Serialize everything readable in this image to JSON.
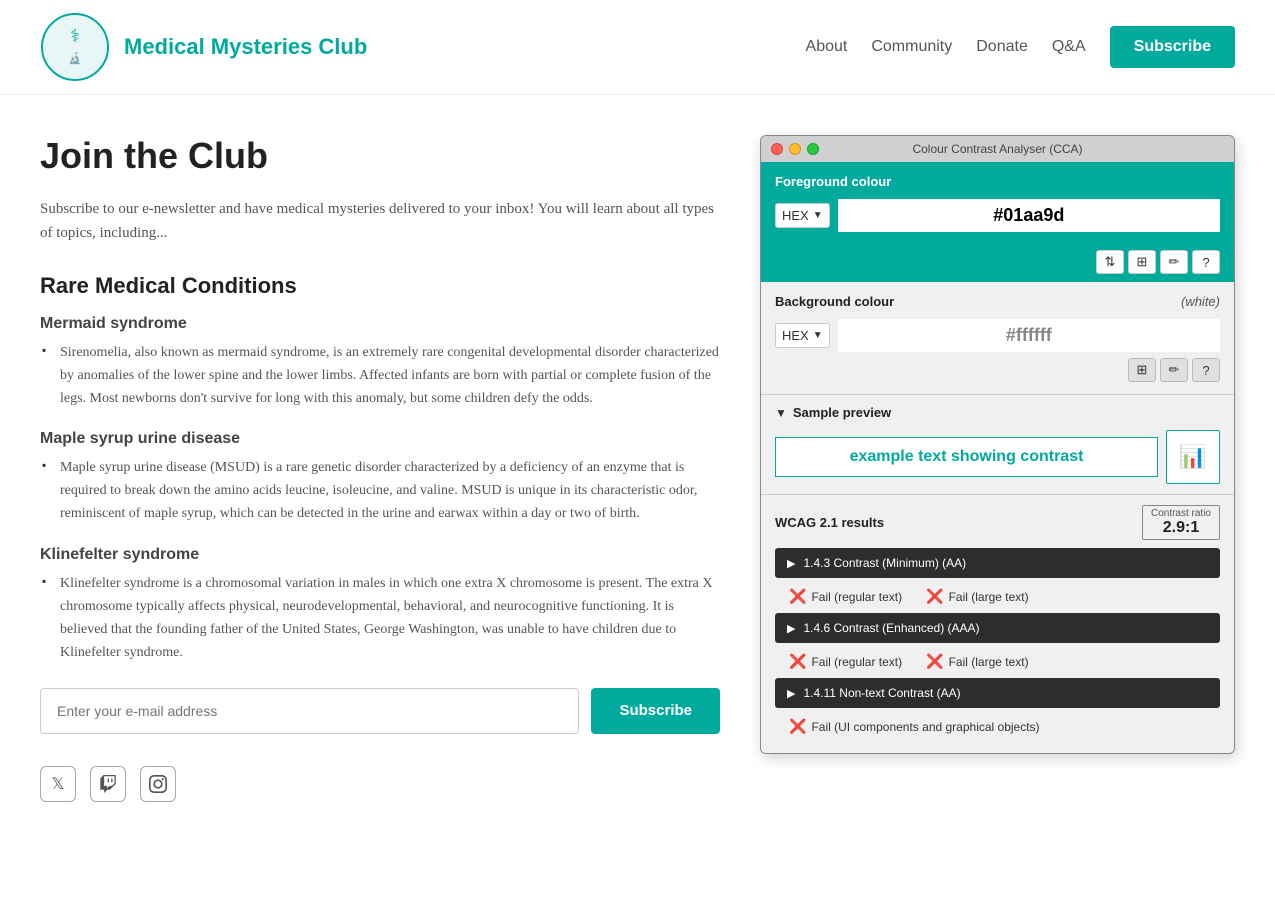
{
  "header": {
    "site_title": "Medical Mysteries Club",
    "nav": {
      "about": "About",
      "community": "Community",
      "donate": "Donate",
      "qa": "Q&A",
      "subscribe": "Subscribe"
    }
  },
  "main": {
    "page_title": "Join the Club",
    "intro": "Subscribe to our e-newsletter and have medical mysteries delivered to your inbox! You will learn about all types of topics, including...",
    "section_heading": "Rare Medical Conditions",
    "conditions": [
      {
        "name": "Mermaid syndrome",
        "description": "Sirenomelia, also known as mermaid syndrome, is an extremely rare congenital developmental disorder characterized by anomalies of the lower spine and the lower limbs. Affected infants are born with partial or complete fusion of the legs. Most newborns don't survive for long with this anomaly, but some children defy the odds."
      },
      {
        "name": "Maple syrup urine disease",
        "description": "Maple syrup urine disease (MSUD) is a rare genetic disorder characterized by a deficiency of an enzyme that is required to break down the amino acids leucine, isoleucine, and valine. MSUD is unique in its characteristic odor, reminiscent of maple syrup, which can be detected in the urine and earwax within a day or two of birth."
      },
      {
        "name": "Klinefelter syndrome",
        "description": "Klinefelter syndrome is a chromosomal variation in males in which one extra X chromosome is present. The extra X chromosome typically affects physical, neurodevelopmental, behavioral, and neurocognitive functioning. It is believed that the founding father of the United States, George Washington, was unable to have children due to Klinefelter syndrome."
      }
    ],
    "email_placeholder": "Enter your e-mail address",
    "form_subscribe_label": "Subscribe"
  },
  "cca": {
    "title": "Colour Contrast Analyser (CCA)",
    "fg_label": "Foreground colour",
    "fg_format": "HEX",
    "fg_value": "#01aa9d",
    "bg_label": "Background colour",
    "bg_white": "(white)",
    "bg_format": "HEX",
    "bg_value": "#ffffff",
    "preview_label": "Sample preview",
    "sample_text": "example text showing contrast",
    "wcag_label": "WCAG 2.1 results",
    "contrast_ratio_label": "Contrast ratio",
    "contrast_ratio_value": "2.9:1",
    "criteria": [
      {
        "label": "1.4.3 Contrast (Minimum) (AA)",
        "results": [
          {
            "type": "fail",
            "text": "Fail (regular text)"
          },
          {
            "type": "fail",
            "text": "Fail (large text)"
          }
        ]
      },
      {
        "label": "1.4.6 Contrast (Enhanced) (AAA)",
        "results": [
          {
            "type": "fail",
            "text": "Fail (regular text)"
          },
          {
            "type": "fail",
            "text": "Fail (large text)"
          }
        ]
      },
      {
        "label": "1.4.11 Non-text Contrast (AA)",
        "results": [
          {
            "type": "fail",
            "text": "Fail (UI components and graphical objects)"
          }
        ]
      }
    ]
  }
}
